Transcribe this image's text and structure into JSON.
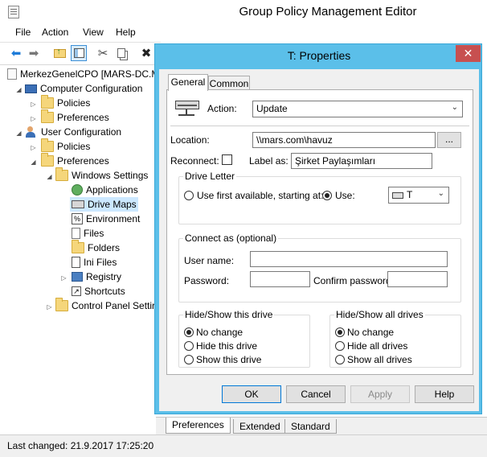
{
  "window": {
    "title": "Group Policy Management Editor"
  },
  "menu": [
    "File",
    "Action",
    "View",
    "Help"
  ],
  "toolbar": {
    "icons": [
      "back-arrow-icon",
      "forward-arrow-icon",
      "up-folder-icon",
      "show-hide-tree-icon",
      "cut-icon",
      "copy-icon",
      "delete-icon"
    ]
  },
  "tree": {
    "root": "MerkezGenelCPO [MARS-DC.M",
    "computer_config": "Computer Configuration",
    "cc_policies": "Policies",
    "cc_preferences": "Preferences",
    "user_config": "User Configuration",
    "uc_policies": "Policies",
    "uc_preferences": "Preferences",
    "windows_settings": "Windows Settings",
    "applications": "Applications",
    "drive_maps": "Drive Maps",
    "environment": "Environment",
    "files": "Files",
    "folders": "Folders",
    "ini_files": "Ini Files",
    "registry": "Registry",
    "shortcuts": "Shortcuts",
    "control_panel": "Control Panel Settir"
  },
  "bottom_tabs": [
    "Preferences",
    "Extended",
    "Standard"
  ],
  "status": "Last changed: 21.9.2017 17:25:20",
  "dialog": {
    "title": "T: Properties",
    "close": "✕",
    "tabs": {
      "general": "General",
      "common": "Common"
    },
    "action_label": "Action:",
    "action_value": "Update",
    "location_label": "Location:",
    "location_value": "\\\\mars.com\\havuz",
    "browse": "...",
    "reconnect_label": "Reconnect:",
    "reconnect_checked": false,
    "label_as_label": "Label as:",
    "label_as_value": "Şirket Paylaşımları",
    "drive_letter_title": "Drive Letter",
    "use_first_label": "Use first available, starting at:",
    "use_label": "Use:",
    "drive_letter_value": "T",
    "connect_as_title": "Connect as (optional)",
    "user_name_label": "User name:",
    "user_name_value": "",
    "password_label": "Password:",
    "password_value": "",
    "confirm_password_label": "Confirm password:",
    "confirm_password_value": "",
    "hide_show_drive_title": "Hide/Show this drive",
    "drive_options": [
      "No change",
      "Hide this drive",
      "Show this drive"
    ],
    "hide_show_all_title": "Hide/Show all drives",
    "all_options": [
      "No change",
      "Hide all drives",
      "Show all drives"
    ],
    "buttons": {
      "ok": "OK",
      "cancel": "Cancel",
      "apply": "Apply",
      "help": "Help"
    }
  }
}
